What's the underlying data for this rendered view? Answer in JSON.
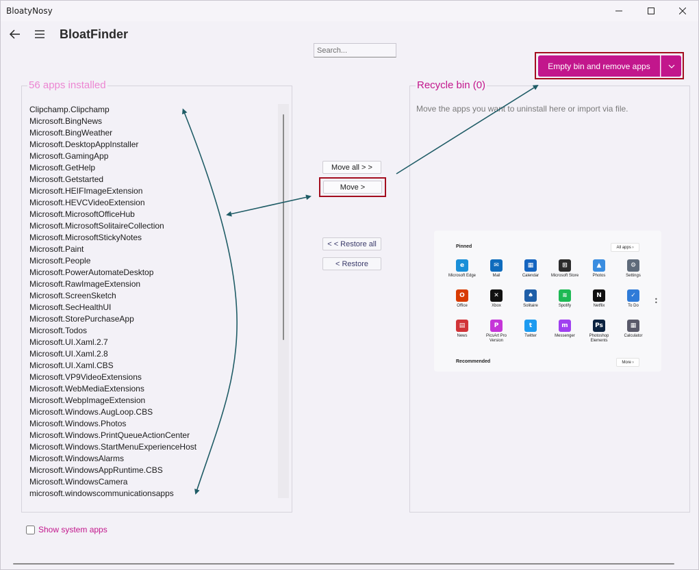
{
  "window": {
    "title": "BloatyNosy"
  },
  "header": {
    "title": "BloatFinder"
  },
  "search": {
    "placeholder": "Search..."
  },
  "actions": {
    "empty_bin": "Empty bin and remove apps"
  },
  "installed": {
    "legend": "56 apps installed",
    "apps": [
      "Clipchamp.Clipchamp",
      "Microsoft.BingNews",
      "Microsoft.BingWeather",
      "Microsoft.DesktopAppInstaller",
      "Microsoft.GamingApp",
      "Microsoft.GetHelp",
      "Microsoft.Getstarted",
      "Microsoft.HEIFImageExtension",
      "Microsoft.HEVCVideoExtension",
      "Microsoft.MicrosoftOfficeHub",
      "Microsoft.MicrosoftSolitaireCollection",
      "Microsoft.MicrosoftStickyNotes",
      "Microsoft.Paint",
      "Microsoft.People",
      "Microsoft.PowerAutomateDesktop",
      "Microsoft.RawImageExtension",
      "Microsoft.ScreenSketch",
      "Microsoft.SecHealthUI",
      "Microsoft.StorePurchaseApp",
      "Microsoft.Todos",
      "Microsoft.UI.Xaml.2.7",
      "Microsoft.UI.Xaml.2.8",
      "Microsoft.UI.Xaml.CBS",
      "Microsoft.VP9VideoExtensions",
      "Microsoft.WebMediaExtensions",
      "Microsoft.WebpImageExtension",
      "Microsoft.Windows.AugLoop.CBS",
      "Microsoft.Windows.Photos",
      "Microsoft.Windows.PrintQueueActionCenter",
      "Microsoft.Windows.StartMenuExperienceHost",
      "Microsoft.WindowsAlarms",
      "Microsoft.WindowsAppRuntime.CBS",
      "Microsoft.WindowsCamera",
      "microsoft.windowscommunicationsapps"
    ]
  },
  "buttons": {
    "move_all": "Move all > >",
    "move": "Move >",
    "restore_all": "< < Restore all",
    "restore": "< Restore"
  },
  "bin": {
    "legend": "Recycle bin (0)",
    "hint": "Move the apps you want to uninstall here or import via file."
  },
  "start_menu": {
    "pinned": "Pinned",
    "all_apps": "All apps",
    "recommended": "Recommended",
    "more": "More",
    "tiles": [
      {
        "label": "Microsoft Edge",
        "icon": "edge-icon",
        "glyph": "e",
        "color": "#1a8fd8"
      },
      {
        "label": "Mail",
        "icon": "mail-icon",
        "glyph": "✉",
        "color": "#0f6cbd"
      },
      {
        "label": "Calendar",
        "icon": "calendar-icon",
        "glyph": "▦",
        "color": "#1565c0"
      },
      {
        "label": "Microsoft Store",
        "icon": "store-icon",
        "glyph": "⊞",
        "color": "#2b2b2b"
      },
      {
        "label": "Photos",
        "icon": "photos-icon",
        "glyph": "▲",
        "color": "#3a8de0"
      },
      {
        "label": "Settings",
        "icon": "settings-icon",
        "glyph": "⚙",
        "color": "#5f6b7a"
      },
      {
        "label": "Office",
        "icon": "office-icon",
        "glyph": "O",
        "color": "#d83b01"
      },
      {
        "label": "Xbox",
        "icon": "xbox-icon",
        "glyph": "✕",
        "color": "#111111"
      },
      {
        "label": "Solitaire",
        "icon": "solitaire-icon",
        "glyph": "♠",
        "color": "#1f5fa8"
      },
      {
        "label": "Spotify",
        "icon": "spotify-icon",
        "glyph": "≋",
        "color": "#1db954"
      },
      {
        "label": "Netflix",
        "icon": "netflix-icon",
        "glyph": "N",
        "color": "#111111"
      },
      {
        "label": "To Do",
        "icon": "todo-icon",
        "glyph": "✓",
        "color": "#2f7bd8"
      },
      {
        "label": "News",
        "icon": "news-icon",
        "glyph": "▤",
        "color": "#d13438"
      },
      {
        "label": "PicsArt Pro Version",
        "icon": "picsart-icon",
        "glyph": "P",
        "color": "#c535d8"
      },
      {
        "label": "Twitter",
        "icon": "twitter-icon",
        "glyph": "t",
        "color": "#1d9bf0"
      },
      {
        "label": "Messenger",
        "icon": "messenger-icon",
        "glyph": "m",
        "color": "#a040f0"
      },
      {
        "label": "Photoshop Elements",
        "icon": "photoshop-icon",
        "glyph": "Ps",
        "color": "#0c2340"
      },
      {
        "label": "Calculator",
        "icon": "calculator-icon",
        "glyph": "▦",
        "color": "#5a5a6a"
      }
    ]
  },
  "options": {
    "show_system_apps": "Show system apps"
  }
}
